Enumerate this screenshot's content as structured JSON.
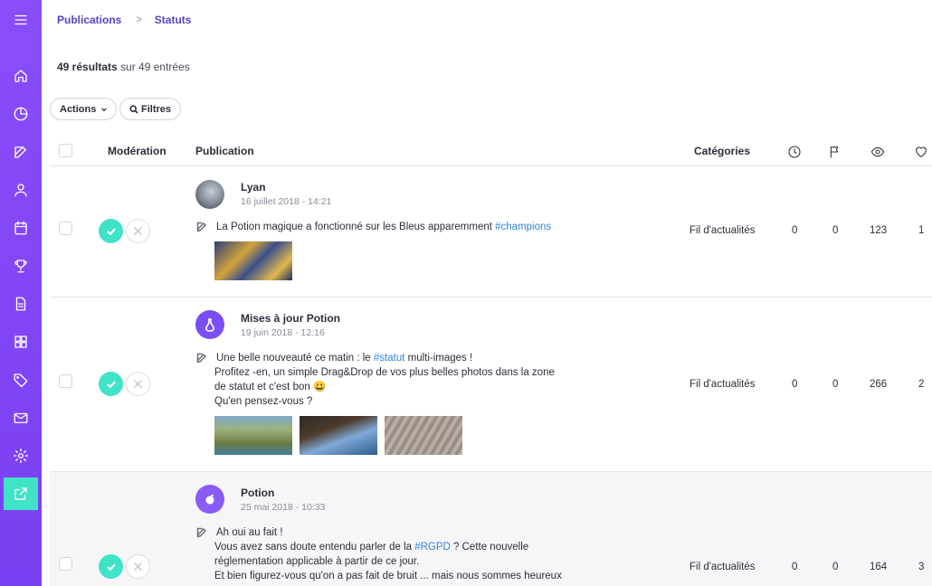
{
  "breadcrumb": {
    "root": "Publications",
    "sep": ">",
    "current": "Statuts"
  },
  "summary": {
    "count": "49 résultats",
    "rest": "sur 49 entrées"
  },
  "toolbar": {
    "actions_label": "Actions",
    "filters_label": "Filtres"
  },
  "table": {
    "headers": {
      "moderation": "Modération",
      "publication": "Publication",
      "categories": "Catégories"
    },
    "header_icons": [
      "clock-icon",
      "flag-icon",
      "eye-icon",
      "heart-icon"
    ]
  },
  "sidebar": {
    "icons": [
      "menu-icon",
      "home-icon",
      "pie-chart-icon",
      "edit-icon",
      "user-icon",
      "calendar-icon",
      "trophy-icon",
      "document-icon",
      "grid-icon",
      "tag-icon",
      "mail-icon",
      "settings-icon",
      "external-link-icon"
    ],
    "active": "external-link-icon"
  },
  "colors": {
    "sidebar": "#7a3ff2",
    "accent": "#3fe3c6",
    "link": "#2f86d9",
    "breadcrumb": "#5a3fc7"
  },
  "rows": [
    {
      "author": "Lyan",
      "date": "16 juillet 2018 - 14:21",
      "lines": [
        {
          "pre": "La Potion magique a fonctionné sur les Bleus apparemment ",
          "tag": "#champions",
          "post": ""
        }
      ],
      "category": "Fil d'actualités",
      "clock": "0",
      "flag": "0",
      "views": "123",
      "likes": "1"
    },
    {
      "author": "Mises à jour Potion",
      "date": "19 juin 2018 - 12:16",
      "lines": [
        {
          "pre": "Une belle nouveauté ce matin : le ",
          "tag": "#statut",
          "post": " multi-images !"
        },
        {
          "pre": "Profitez -en, un simple Drag&Drop de vos plus belles photos dans la zone",
          "tag": "",
          "post": ""
        },
        {
          "pre": "de statut et c'est bon 😀",
          "tag": "",
          "post": ""
        },
        {
          "pre": "Qu'en pensez-vous ?",
          "tag": "",
          "post": ""
        }
      ],
      "category": "Fil d'actualités",
      "clock": "0",
      "flag": "0",
      "views": "266",
      "likes": "2"
    },
    {
      "author": "Potion",
      "date": "25 mai 2018 - 10:33",
      "lines": [
        {
          "pre": "Ah oui au fait !",
          "tag": "",
          "post": ""
        },
        {
          "pre": "Vous avez sans doute entendu parler de la ",
          "tag": "#RGPD",
          "post": " ? Cette nouvelle"
        },
        {
          "pre": "réglementation applicable à partir de ce jour.",
          "tag": "",
          "post": ""
        },
        {
          "pre": "Et bien figurez-vous qu'on a pas fait de bruit ... mais nous sommes heureux",
          "tag": "",
          "post": ""
        }
      ],
      "category": "Fil d'actualités",
      "clock": "0",
      "flag": "0",
      "views": "164",
      "likes": "3"
    }
  ]
}
